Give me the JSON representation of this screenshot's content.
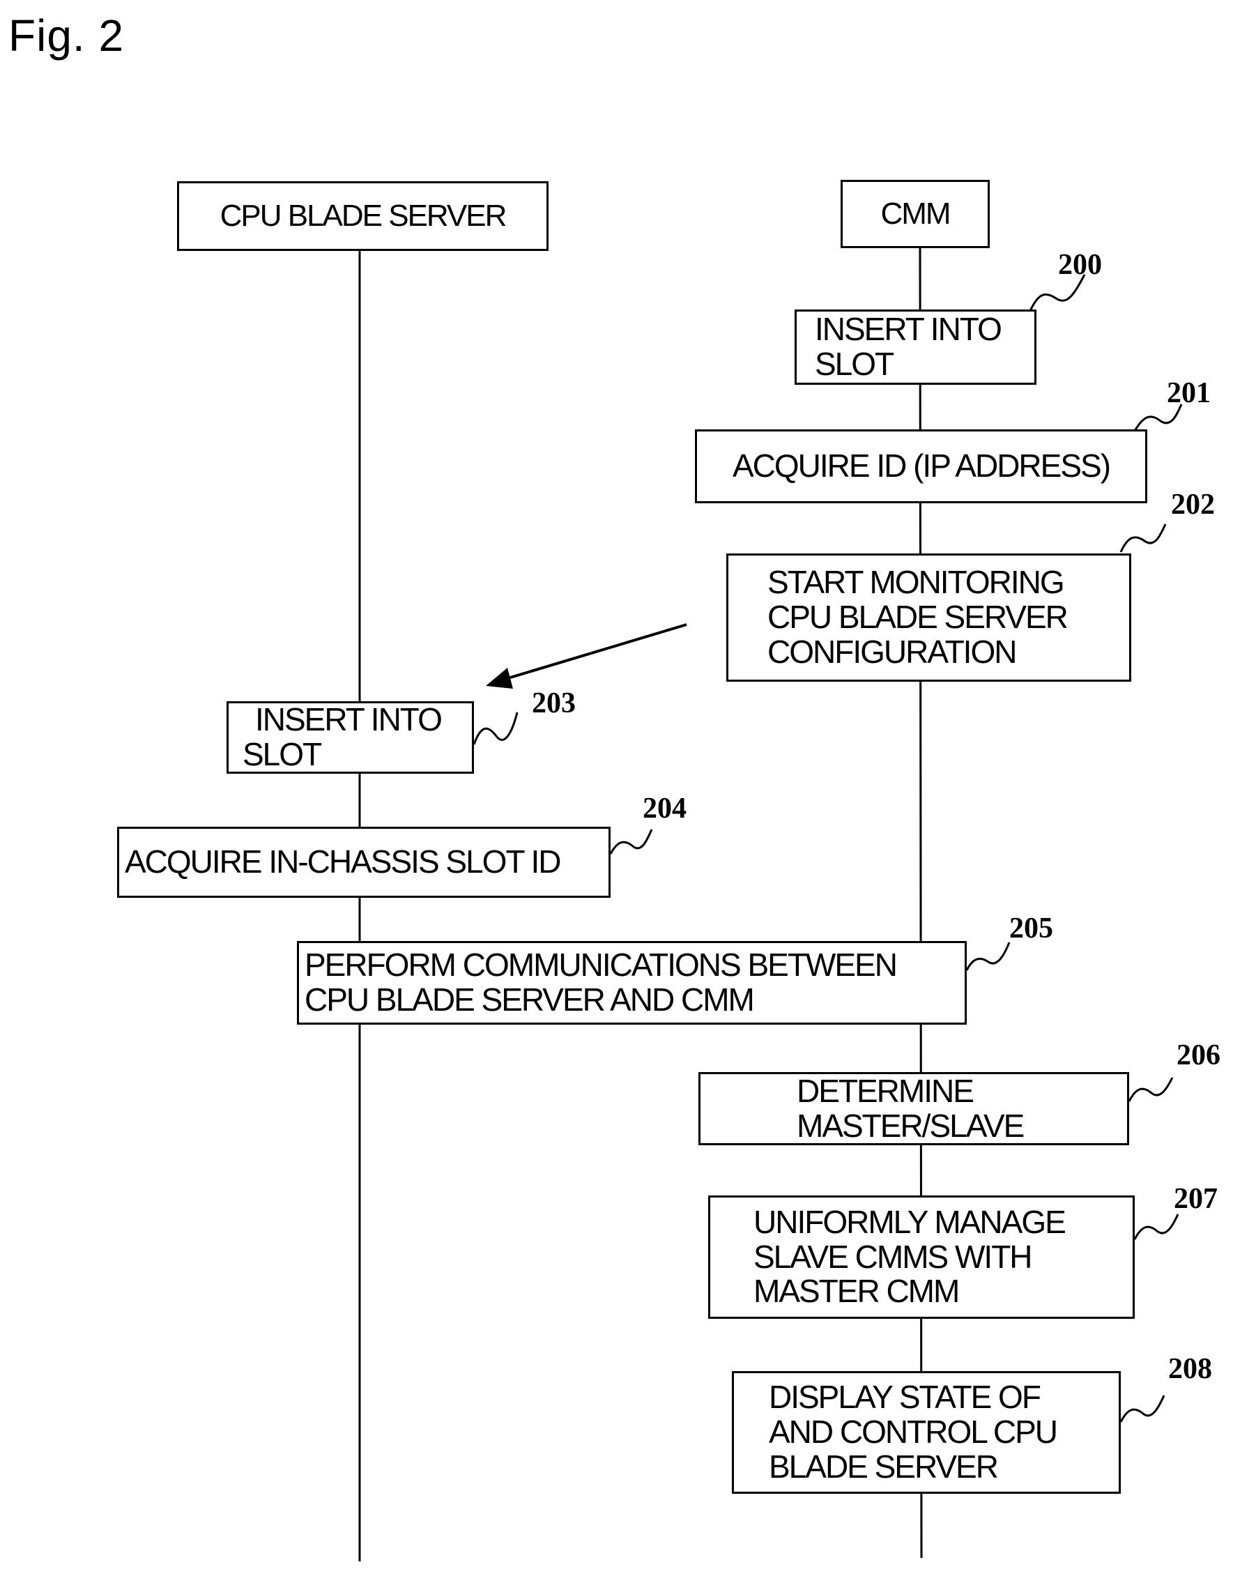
{
  "figure_label": "Fig. 2",
  "lanes": {
    "left": "CPU BLADE SERVER",
    "right": "CMM"
  },
  "steps": [
    {
      "ref": "200",
      "lane": "CMM",
      "lines": [
        "INSERT INTO",
        "SLOT"
      ]
    },
    {
      "ref": "201",
      "lane": "CMM",
      "lines": [
        "ACQUIRE ID (IP ADDRESS)"
      ]
    },
    {
      "ref": "202",
      "lane": "CMM",
      "lines": [
        "START MONITORING",
        "CPU BLADE SERVER",
        "CONFIGURATION"
      ]
    },
    {
      "ref": "203",
      "lane": "CPU BLADE SERVER",
      "lines": [
        "INSERT INTO",
        "SLOT"
      ]
    },
    {
      "ref": "204",
      "lane": "CPU BLADE SERVER",
      "lines": [
        "ACQUIRE IN-CHASSIS SLOT ID"
      ]
    },
    {
      "ref": "205",
      "lane": "both",
      "lines": [
        "PERFORM COMMUNICATIONS BETWEEN",
        "CPU BLADE SERVER AND CMM"
      ]
    },
    {
      "ref": "206",
      "lane": "CMM",
      "lines": [
        "DETERMINE",
        "MASTER/SLAVE"
      ]
    },
    {
      "ref": "207",
      "lane": "CMM",
      "lines": [
        "UNIFORMLY MANAGE",
        "SLAVE CMMS WITH",
        "MASTER CMM"
      ]
    },
    {
      "ref": "208",
      "lane": "CMM",
      "lines": [
        "DISPLAY STATE OF",
        "AND CONTROL CPU",
        "BLADE SERVER"
      ]
    }
  ],
  "arrows": [
    {
      "from": "202",
      "to": "203",
      "meaning": "CMM monitoring detects CPU blade server insertion"
    }
  ]
}
